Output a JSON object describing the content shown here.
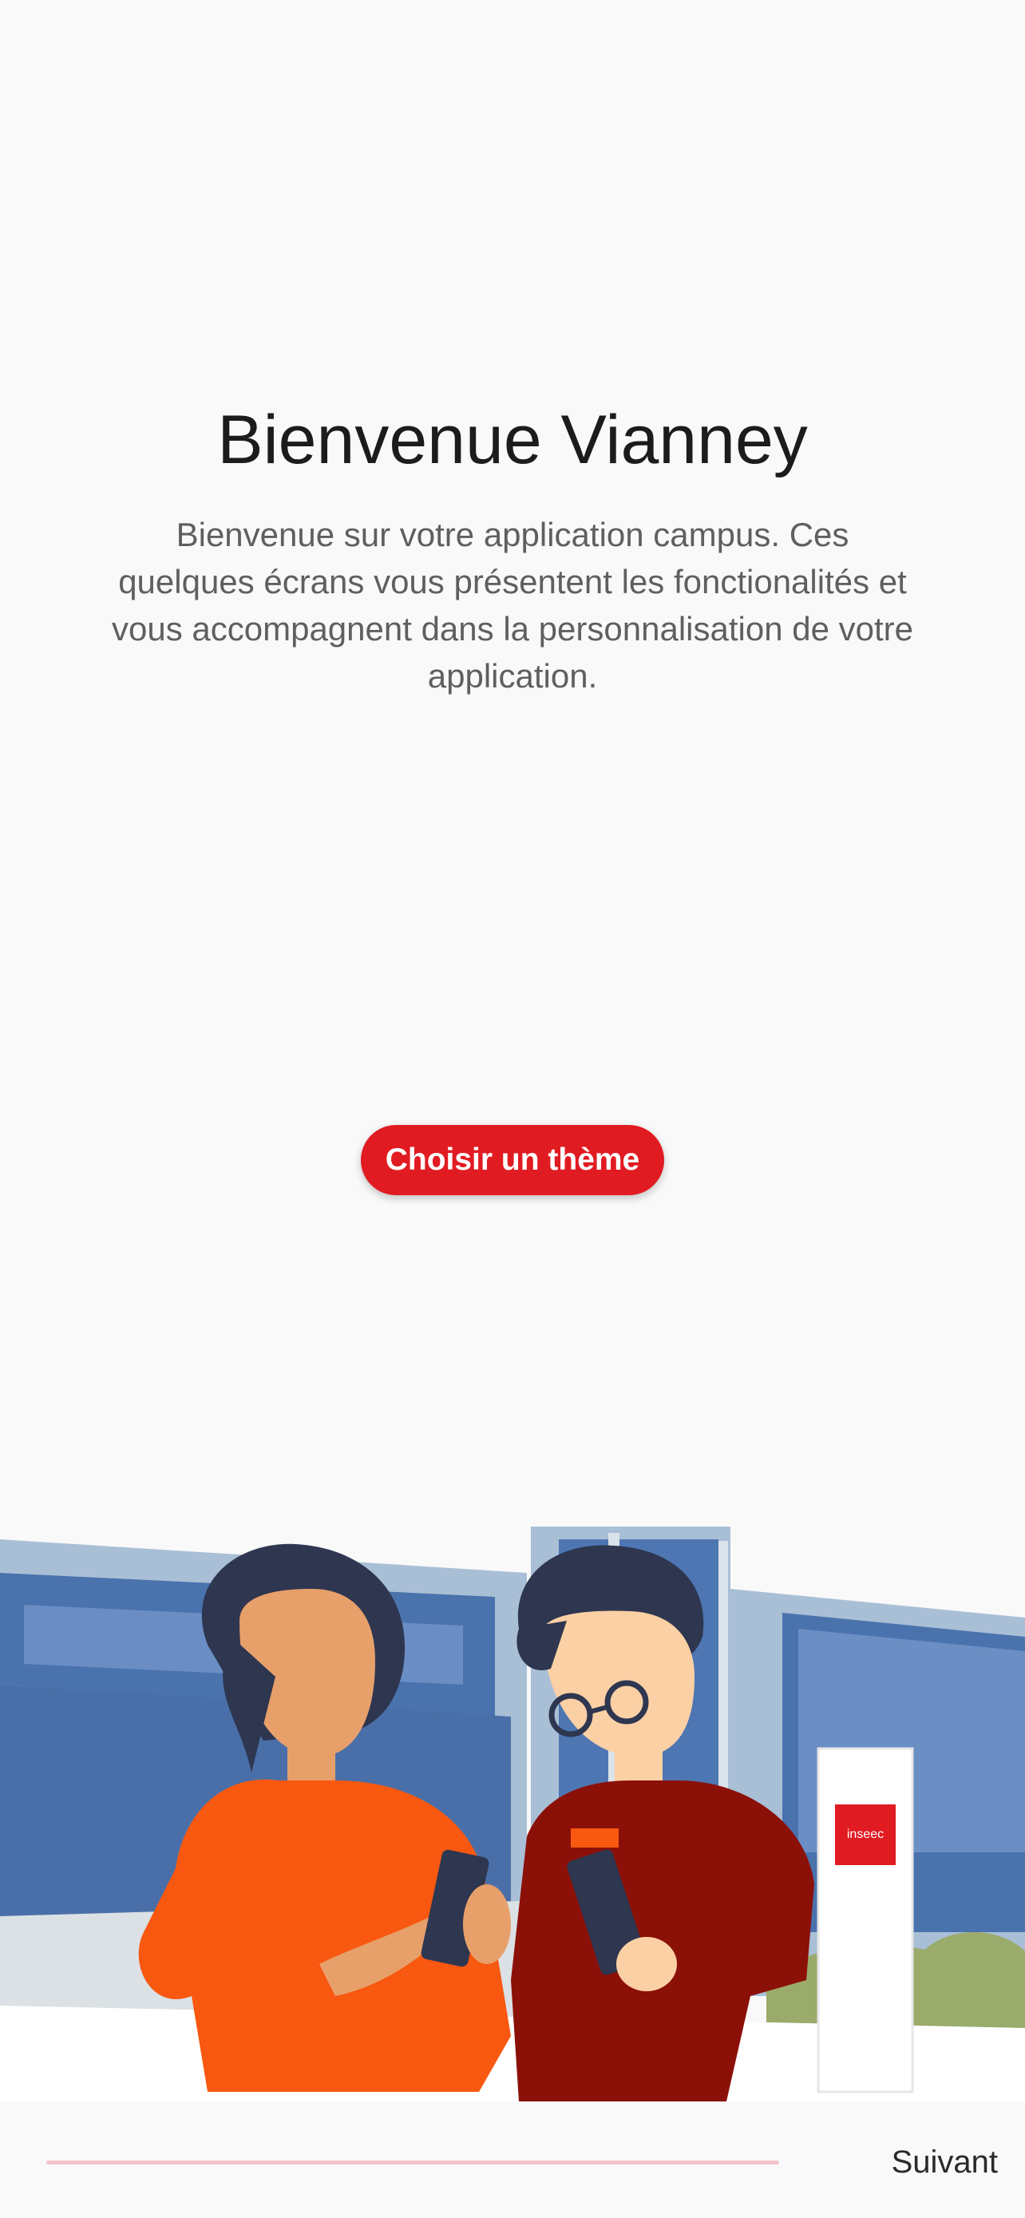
{
  "welcome": {
    "title": "Bienvenue Vianney",
    "description": "Bienvenue sur votre application campus. Ces quelques écrans vous présentent les fonctionalités et vous accompagnent dans la personnalisation de votre application.",
    "theme_button": "Choisir un thème"
  },
  "illustration": {
    "sign_text": "inseec",
    "icon": "students-campus-illustration"
  },
  "footer": {
    "progress": 0.0,
    "next_label": "Suivant"
  },
  "colors": {
    "accent": "#e11b22",
    "background": "#f9f9f9",
    "progress_track": "#f5c2c8"
  }
}
